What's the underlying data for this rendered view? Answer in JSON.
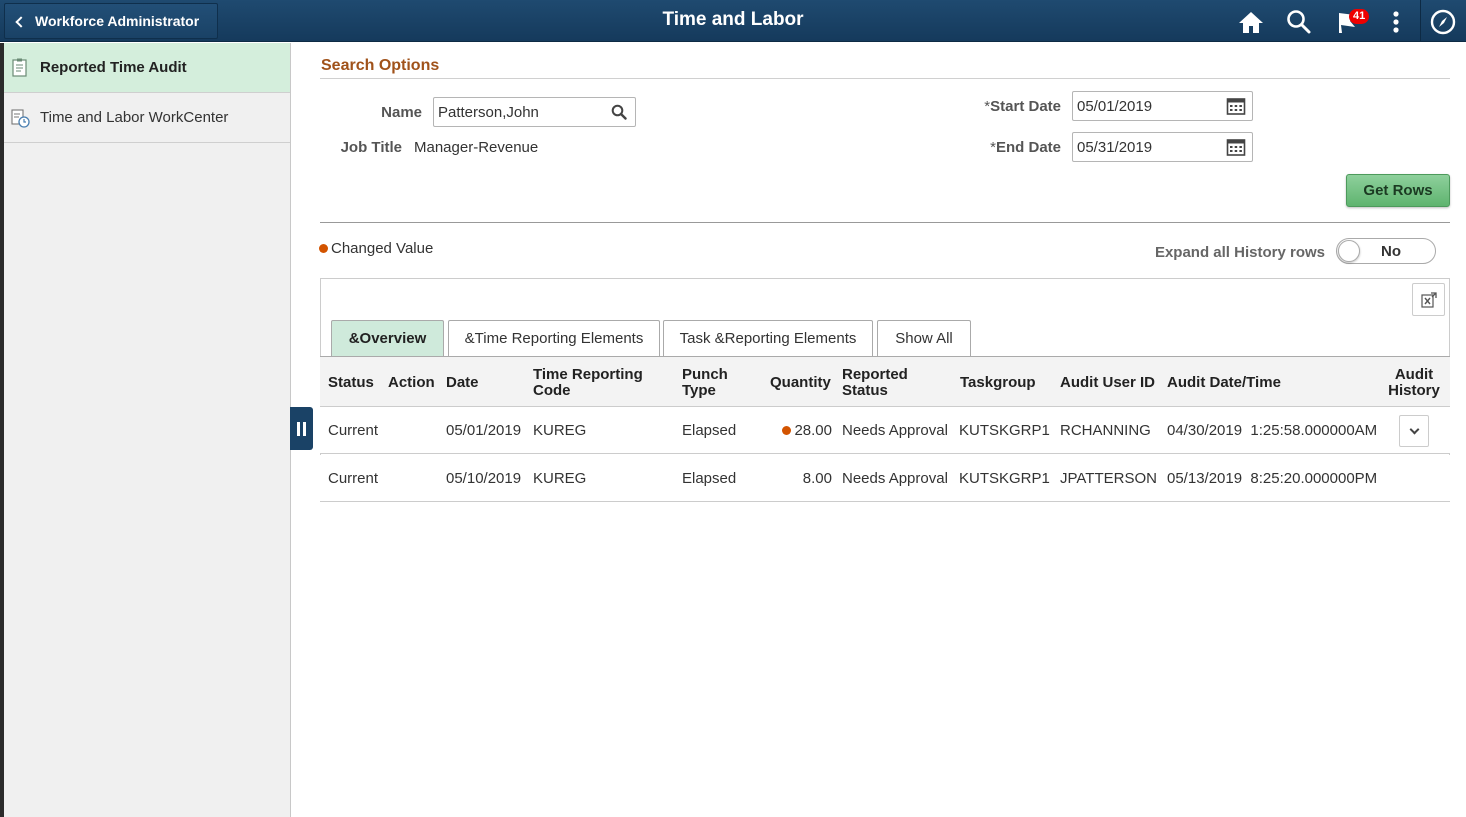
{
  "header": {
    "back_label": "Workforce Administrator",
    "title": "Time and Labor",
    "notification_count": "41",
    "icons": [
      "home-icon",
      "search-icon",
      "flag-icon",
      "more-options-icon",
      "navbar-compass-icon"
    ]
  },
  "sidebar": {
    "items": [
      {
        "label": "Reported Time Audit",
        "active": true
      },
      {
        "label": "Time and Labor WorkCenter",
        "active": false
      }
    ]
  },
  "search": {
    "section_title": "Search Options",
    "name_label": "Name",
    "name_value": "Patterson,John",
    "job_title_label": "Job Title",
    "job_title_value": "Manager-Revenue",
    "start_date_label": "Start Date",
    "start_date_value": "05/01/2019",
    "end_date_label": "End Date",
    "end_date_value": "05/31/2019",
    "required_marker": "*",
    "get_rows_label": "Get Rows"
  },
  "legend": {
    "changed_value_label": "Changed Value",
    "changed_color": "#d35400"
  },
  "expand": {
    "label": "Expand all History rows",
    "toggle_value": "No"
  },
  "grid": {
    "tabs": [
      {
        "label": "&Overview",
        "active": true
      },
      {
        "label": "&Time Reporting Elements",
        "active": false
      },
      {
        "label": "Task &Reporting Elements",
        "active": false
      },
      {
        "label": "Show All",
        "active": false
      }
    ],
    "columns": {
      "status": "Status",
      "action": "Action",
      "date": "Date",
      "trc_1": "Time Reporting",
      "trc_2": "Code",
      "punch_1": "Punch",
      "punch_2": "Type",
      "quantity": "Quantity",
      "rstatus_1": "Reported",
      "rstatus_2": "Status",
      "taskgroup": "Taskgroup",
      "audit_user": "Audit User ID",
      "audit_dt": "Audit Date/Time",
      "hist_1": "Audit",
      "hist_2": "History"
    },
    "rows": [
      {
        "status": "Current",
        "action": "",
        "date": "05/01/2019",
        "trc": "KUREG",
        "punch_type": "Elapsed",
        "quantity": "28.00",
        "changed": true,
        "reported_status": "Needs Approval",
        "taskgroup": "KUTSKGRP1",
        "audit_user": "RCHANNING",
        "audit_dt": "04/30/2019  1:25:58.000000AM",
        "has_history": true
      },
      {
        "status": "Current",
        "action": "",
        "date": "05/10/2019",
        "trc": "KUREG",
        "punch_type": "Elapsed",
        "quantity": "8.00",
        "changed": false,
        "reported_status": "Needs Approval",
        "taskgroup": "KUTSKGRP1",
        "audit_user": "JPATTERSON",
        "audit_dt": "05/13/2019  8:25:20.000000PM",
        "has_history": false
      }
    ]
  }
}
